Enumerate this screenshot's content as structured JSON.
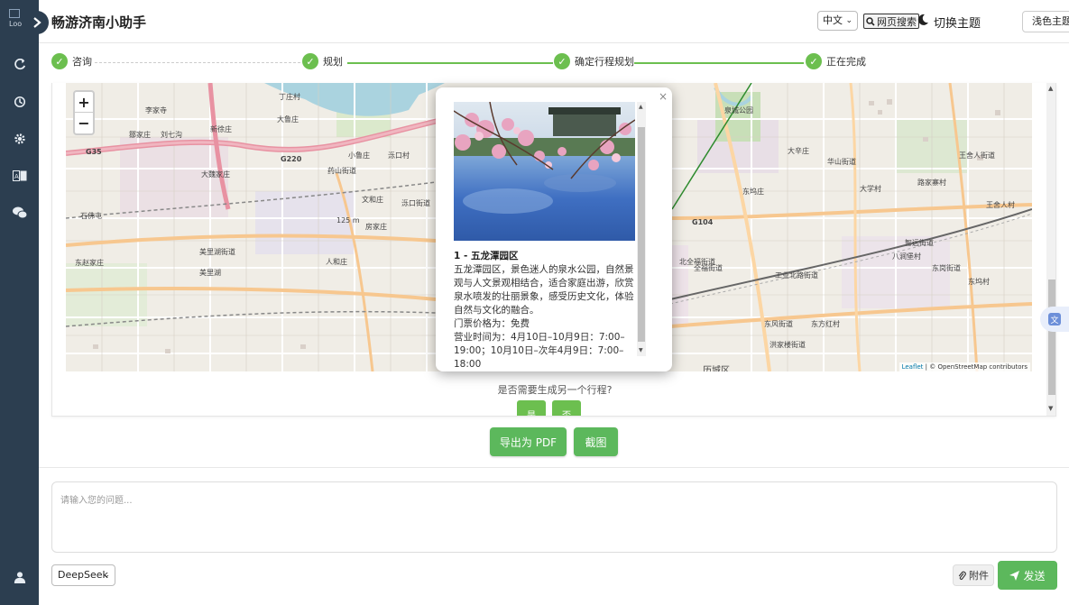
{
  "header": {
    "app_title": "畅游济南小助手",
    "logo_alt": "Loo",
    "language": "中文",
    "web_search_label": "网页搜索",
    "theme_toggle_label": "切换主题",
    "theme_value": "浅色主题"
  },
  "steps": [
    {
      "label": "咨询"
    },
    {
      "label": "规划"
    },
    {
      "label": "确定行程规划"
    },
    {
      "label": "正在完成"
    }
  ],
  "map": {
    "zoom_in": "+",
    "zoom_out": "−",
    "attribution_leaflet": "Leaflet",
    "attribution_rest": "| © OpenStreetMap contributors",
    "labels": [
      "丁庄村",
      "李家寺",
      "大鲁庄",
      "鄒家庄",
      "刘七沟",
      "新徐庄",
      "小鲁庄",
      "泺口村",
      "G35",
      "G220",
      "大魏家庄",
      "药山街道",
      "文和庄",
      "泺口街道",
      "石佛屯",
      "125 m",
      "房家庄",
      "东赵家庄",
      "美里湖街道",
      "美里湖",
      "人和庄",
      "北全福街道",
      "全福街道",
      "八涧堡村",
      "工业北路街道",
      "智远街道",
      "东岗街道",
      "东坞村",
      "历城区",
      "东风街道",
      "东方红村",
      "洪家楼街道",
      "G104",
      "泉城公园",
      "大学村",
      "华山街道",
      "王舍人街道",
      "路家寨村",
      "东坞庄",
      "大辛庄",
      "王舍人村"
    ],
    "label_prefix_note": ""
  },
  "popup": {
    "close": "×",
    "title": "1 - 五龙潭园区",
    "description": "五龙潭园区，景色迷人的泉水公园，自然景观与人文景观相结合，适合家庭出游，欣赏泉水喷发的壮丽景象，感受历史文化，体验自然与文化的融合。",
    "ticket": "门票价格为：免费",
    "hours": "营业时间为：4月10日–10月9日：7:00–19:00；10月10日–次年4月9日：7:00–18:00"
  },
  "question": "是否需要生成另一个行程?",
  "yes_label": "是",
  "no_label": "否",
  "export_pdf_label": "导出为 PDF",
  "screenshot_label": "截图",
  "chat": {
    "placeholder": "请输入您的问题...",
    "model": "DeepSeek",
    "attach_label": "附件",
    "send_label": "发送"
  },
  "colors": {
    "sidebar": "#2c3e50",
    "accent_green": "#5cb85c",
    "step_green": "#6cbf4f"
  }
}
